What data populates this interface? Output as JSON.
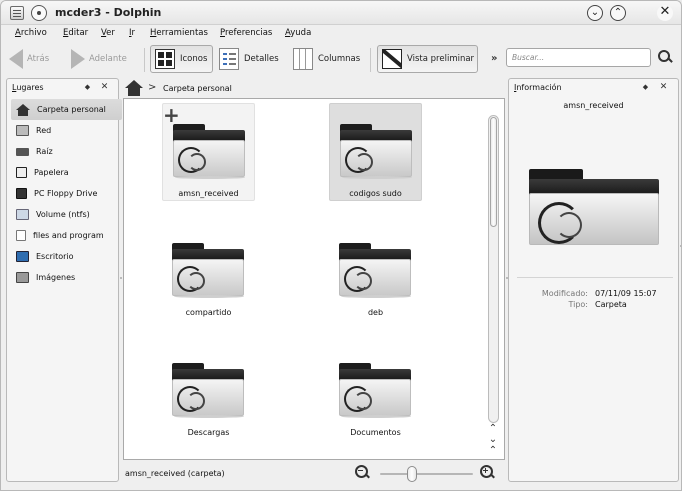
{
  "window": {
    "title": "mcder3 - Dolphin",
    "shade_symbol": "⌄",
    "maximize_symbol": "⌃",
    "close_symbol": "✕"
  },
  "menubar": {
    "items": [
      {
        "first": "A",
        "rest": "rchivo"
      },
      {
        "first": "E",
        "rest": "ditar"
      },
      {
        "first": "V",
        "rest": "er"
      },
      {
        "first": "I",
        "rest": "r"
      },
      {
        "first": "H",
        "rest": "erramientas"
      },
      {
        "first": "P",
        "rest": "referencias"
      },
      {
        "first": "A",
        "rest": "yuda"
      }
    ]
  },
  "toolbar": {
    "back_label": "Atrás",
    "forward_label": "Adelante",
    "icons_label": "Iconos",
    "details_label": "Detalles",
    "columns_label": "Columnas",
    "preview_label": "Vista preliminar",
    "overflow": "»",
    "search_placeholder": "Buscar..."
  },
  "places": {
    "title_first": "L",
    "title_rest": "ugares",
    "pin": "◆",
    "close": "✕",
    "items": [
      {
        "label": "Carpeta personal",
        "icon": "home-icon",
        "active": true
      },
      {
        "label": "Red",
        "icon": "network-icon",
        "active": false
      },
      {
        "label": "Raíz",
        "icon": "root-drive-icon",
        "active": false
      },
      {
        "label": "Papelera",
        "icon": "trash-icon",
        "active": false
      },
      {
        "label": "PC Floppy Drive",
        "icon": "floppy-icon",
        "active": false
      },
      {
        "label": "Volume (ntfs)",
        "icon": "volume-icon",
        "active": false
      },
      {
        "label": "files and program",
        "icon": "document-icon",
        "active": false
      },
      {
        "label": "Escritorio",
        "icon": "desktop-icon",
        "active": false
      },
      {
        "label": "Imágenes",
        "icon": "images-icon",
        "active": false
      }
    ]
  },
  "breadcrumb": {
    "separator": ">",
    "current": "Carpeta personal"
  },
  "files": [
    {
      "name": "amsn_received",
      "state": "hover"
    },
    {
      "name": "codigos sudo",
      "state": "selected"
    },
    {
      "name": "compartido",
      "state": "normal"
    },
    {
      "name": "deb",
      "state": "normal"
    },
    {
      "name": "Descargas",
      "state": "normal"
    },
    {
      "name": "Documentos",
      "state": "normal"
    }
  ],
  "scrollbar": {
    "up_symbol": "⌃",
    "down_symbol": "⌄",
    "up2_symbol": "⌃",
    "position": 0.0
  },
  "statusbar": {
    "text": "amsn_received (carpeta)",
    "zoom_level": 0.33
  },
  "info": {
    "title_first": "I",
    "title_rest": "nformación",
    "pin": "◆",
    "close": "✕",
    "name": "amsn_received",
    "modified_key": "Modificado:",
    "modified_value": "07/11/09 15:07",
    "type_key": "Tipo:",
    "type_value": "Carpeta"
  }
}
